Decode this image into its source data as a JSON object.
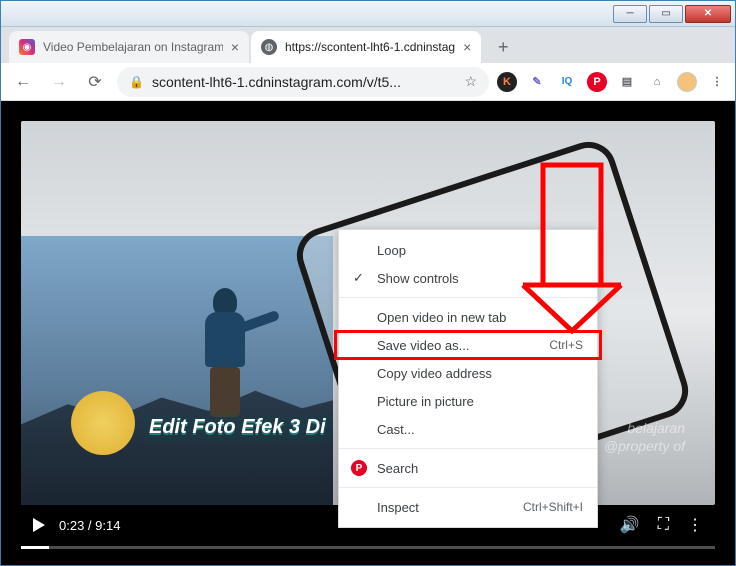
{
  "tabs": [
    {
      "title": "Video Pembelajaran on Instagram"
    },
    {
      "title": "https://scontent-lht6-1.cdninstag"
    }
  ],
  "address": {
    "url_display": "scontent-lht6-1.cdninstagram.com/v/t5..."
  },
  "video": {
    "time_current": "0:23",
    "time_total": "9:14",
    "badge_text": "Edit Foto Efek 3 Di",
    "watermark_line1": "belajaran",
    "watermark_line2": "@property of"
  },
  "context_menu": {
    "loop": "Loop",
    "show_controls": "Show controls",
    "open_new_tab": "Open video in new tab",
    "save_as": "Save video as...",
    "save_as_shortcut": "Ctrl+S",
    "copy_address": "Copy video address",
    "pip": "Picture in picture",
    "cast": "Cast...",
    "search": "Search",
    "inspect": "Inspect",
    "inspect_shortcut": "Ctrl+Shift+I"
  },
  "ext_icons": {
    "k": "K",
    "iq": "IQ"
  }
}
